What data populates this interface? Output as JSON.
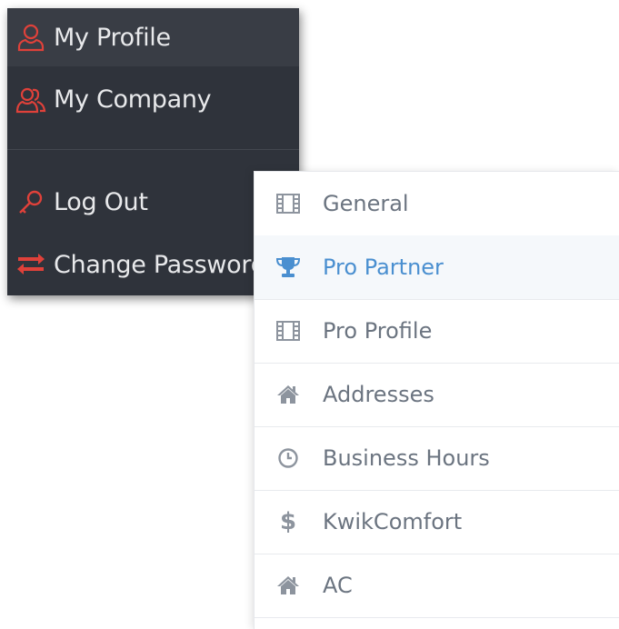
{
  "account_menu": {
    "items": [
      {
        "label": "My Profile",
        "icon": "user-icon",
        "active": true
      },
      {
        "label": "My Company",
        "icon": "users-icon",
        "active": false
      },
      {
        "label": "Log Out",
        "icon": "key-icon",
        "active": false
      },
      {
        "label": "Change Password",
        "icon": "exchange-icon",
        "active": false
      }
    ]
  },
  "settings_nav": {
    "items": [
      {
        "label": "General",
        "icon": "film-icon",
        "active": false
      },
      {
        "label": "Pro Partner",
        "icon": "trophy-icon",
        "active": true
      },
      {
        "label": "Pro Profile",
        "icon": "film-icon",
        "active": false
      },
      {
        "label": "Addresses",
        "icon": "home-icon",
        "active": false
      },
      {
        "label": "Business Hours",
        "icon": "clock-icon",
        "active": false
      },
      {
        "label": "KwikComfort",
        "icon": "dollar-icon",
        "active": false
      },
      {
        "label": "AC",
        "icon": "home-icon",
        "active": false
      }
    ]
  },
  "colors": {
    "menu_bg": "#2f333b",
    "menu_icon": "#e0413a",
    "nav_text": "#6b7480",
    "nav_icon": "#8d949e",
    "nav_active": "#4a8fd0"
  }
}
